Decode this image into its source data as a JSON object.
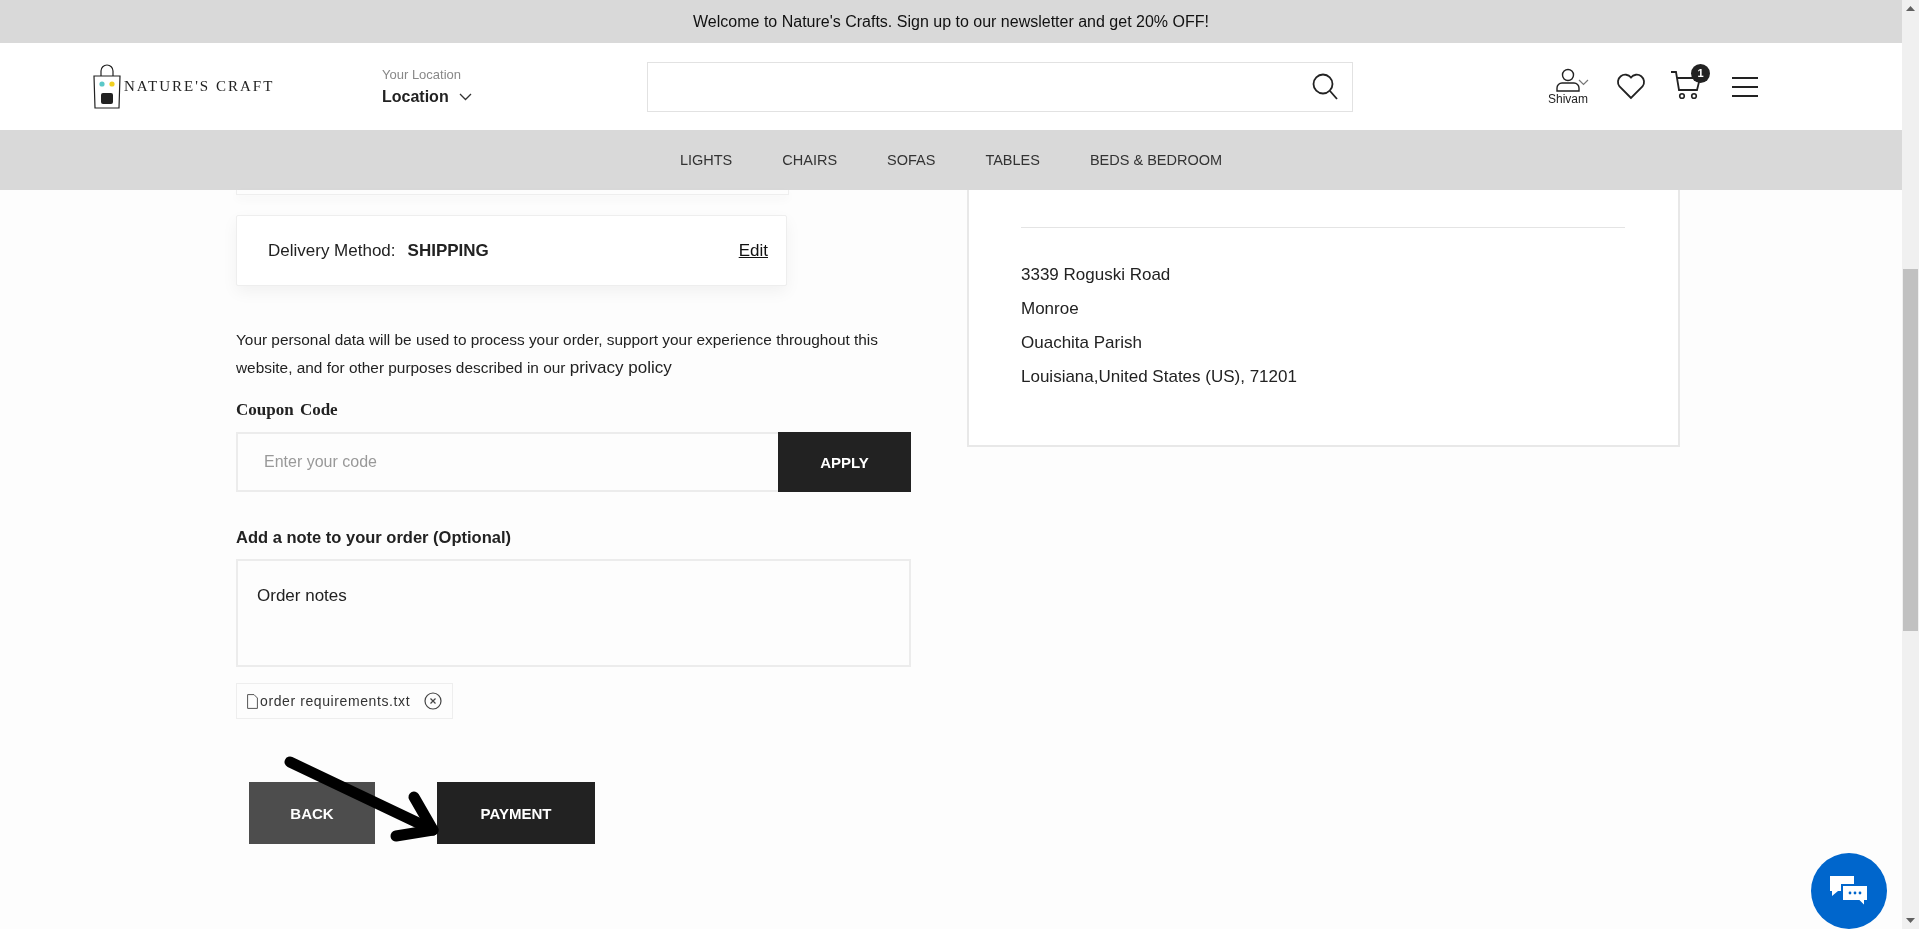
{
  "announcement": "Welcome to Nature's Crafts. Sign up to our newsletter and get 20% OFF!",
  "header": {
    "logo_text": "NATURE'S CRAFT",
    "location_label": "Your Location",
    "location_value": "Location",
    "user_name": "Shivam",
    "cart_count": "1"
  },
  "nav": [
    "LIGHTS",
    "CHAIRS",
    "SOFAS",
    "TABLES",
    "BEDS & BEDROOM"
  ],
  "delivery": {
    "label": "Delivery Method:",
    "value": "SHIPPING",
    "edit": "Edit"
  },
  "privacy": {
    "text": "Your personal data will be used to process your order, support your experience throughout this website, and for other purposes described in our",
    "link": "privacy policy"
  },
  "coupon": {
    "label": "Coupon Code",
    "placeholder": "Enter your code",
    "button": "APPLY"
  },
  "note": {
    "label": "Add a note to your order (Optional)",
    "placeholder": "Order notes"
  },
  "attachment": {
    "name": "order requirements.txt"
  },
  "buttons": [
    {
      "label": "BACK",
      "kind": "secondary"
    },
    {
      "label": "PAYMENT",
      "kind": "primary"
    }
  ],
  "address": [
    "3339 Roguski Road",
    "Monroe",
    "Ouachita Parish",
    "Louisiana,United States (US), 71201"
  ]
}
